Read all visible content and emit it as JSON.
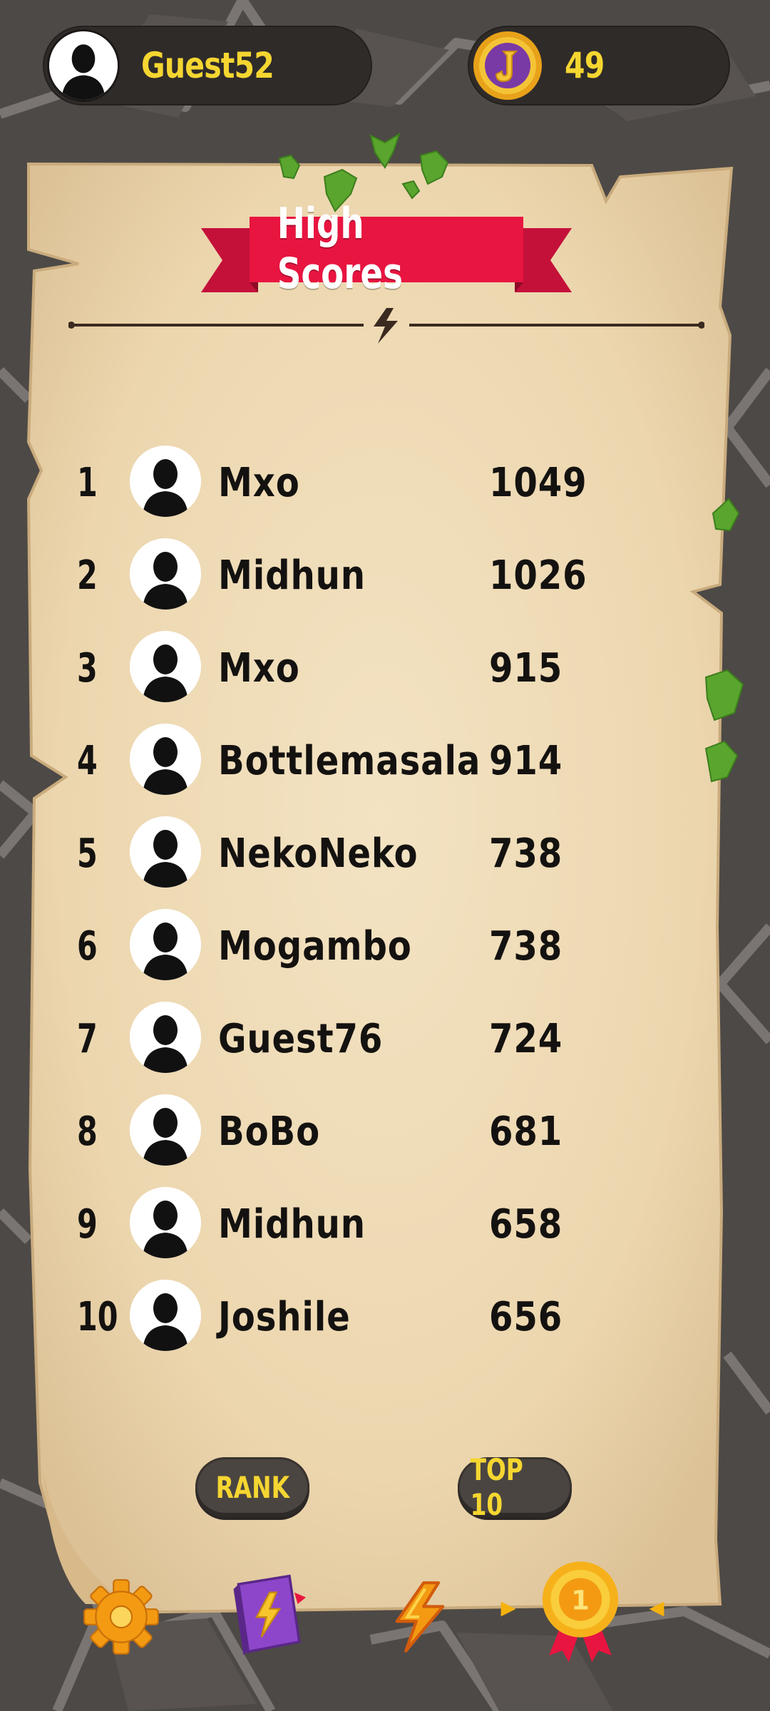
{
  "user": {
    "name": "Guest52"
  },
  "wallet": {
    "coins": "49"
  },
  "title": "High Scores",
  "leaderboard": [
    {
      "rank": "1",
      "name": "Mxo",
      "score": "1049"
    },
    {
      "rank": "2",
      "name": "Midhun",
      "score": "1026"
    },
    {
      "rank": "3",
      "name": "Mxo",
      "score": "915"
    },
    {
      "rank": "4",
      "name": "Bottlemasala",
      "score": "914"
    },
    {
      "rank": "5",
      "name": "NekoNeko",
      "score": "738"
    },
    {
      "rank": "6",
      "name": "Mogambo",
      "score": "738"
    },
    {
      "rank": "7",
      "name": "Guest76",
      "score": "724"
    },
    {
      "rank": "8",
      "name": "BoBo",
      "score": "681"
    },
    {
      "rank": "9",
      "name": "Midhun",
      "score": "658"
    },
    {
      "rank": "10",
      "name": "Joshile",
      "score": "656"
    }
  ],
  "buttons": {
    "rank": "RANK",
    "top10": "TOP 10"
  },
  "nav": {
    "items": [
      "settings-icon",
      "book-icon",
      "lightning-icon",
      "medal-icon"
    ],
    "active_item": "medal-icon"
  },
  "colors": {
    "accent_yellow": "#f5d631",
    "banner_red": "#e81540",
    "parchment": "#efdcb9",
    "dark_pill": "#2f2b29"
  }
}
